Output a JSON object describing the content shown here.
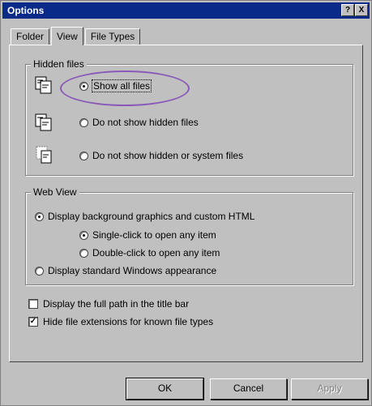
{
  "window": {
    "title": "Options",
    "help_btn": "?",
    "close_btn": "X"
  },
  "tabs": [
    {
      "label": "Folder"
    },
    {
      "label": "View"
    },
    {
      "label": "File Types"
    }
  ],
  "hidden_files": {
    "label": "Hidden files",
    "options": [
      {
        "label": "Show all files",
        "checked": true
      },
      {
        "label": "Do not show hidden files",
        "checked": false
      },
      {
        "label": "Do not show hidden or system files",
        "checked": false
      }
    ]
  },
  "web_view": {
    "label": "Web View",
    "option_custom": "Display background graphics and custom HTML",
    "option_single": "Single-click to open any item",
    "option_double": "Double-click to open any item",
    "option_standard": "Display standard Windows appearance"
  },
  "checks": {
    "full_path": {
      "label": "Display the full path in the title bar",
      "checked": false
    },
    "hide_ext": {
      "label": "Hide file extensions for known file types",
      "checked": true
    }
  },
  "buttons": {
    "ok": "OK",
    "cancel": "Cancel",
    "apply": "Apply"
  },
  "colors": {
    "titlebar": "#0a2a8a",
    "dialog": "#c0c0c0",
    "oval": "#8a5ab8"
  }
}
